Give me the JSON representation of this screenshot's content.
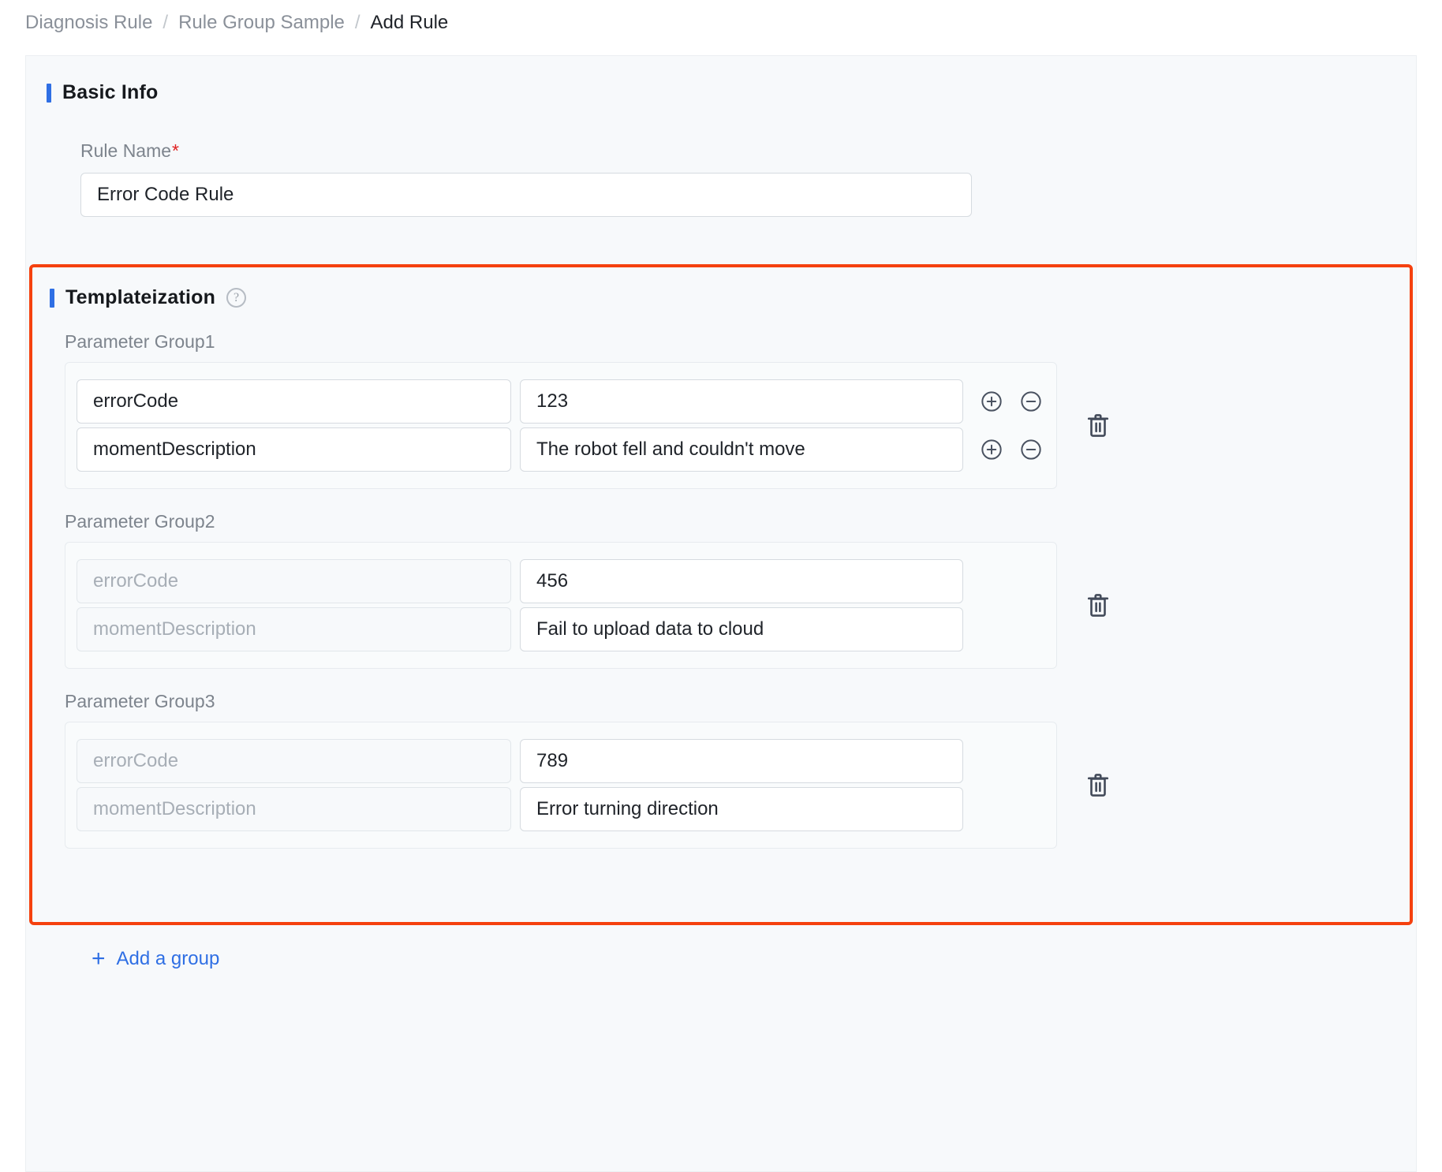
{
  "breadcrumb": {
    "separator": "/",
    "items": [
      {
        "label": "Diagnosis Rule",
        "active": false
      },
      {
        "label": "Rule Group Sample",
        "active": false
      },
      {
        "label": "Add Rule",
        "active": true
      }
    ]
  },
  "basic_info": {
    "title": "Basic Info",
    "rule_name": {
      "label": "Rule Name",
      "required_marker": "*",
      "value": "Error Code Rule",
      "placeholder": "Please enter rule name"
    }
  },
  "templateization": {
    "title": "Templateization",
    "help_icon": "question-circle-icon",
    "groups": [
      {
        "label": "Parameter Group1",
        "has_row_icons": true,
        "rows": [
          {
            "key": "errorCode",
            "key_disabled": false,
            "value": "123"
          },
          {
            "key": "momentDescription",
            "key_disabled": false,
            "value": "The robot fell and couldn't move"
          }
        ]
      },
      {
        "label": "Parameter Group2",
        "has_row_icons": false,
        "rows": [
          {
            "key": "errorCode",
            "key_disabled": true,
            "value": "456"
          },
          {
            "key": "momentDescription",
            "key_disabled": true,
            "value": "Fail to upload data to cloud"
          }
        ]
      },
      {
        "label": "Parameter Group3",
        "has_row_icons": false,
        "rows": [
          {
            "key": "errorCode",
            "key_disabled": true,
            "value": "789"
          },
          {
            "key": "momentDescription",
            "key_disabled": true,
            "value": "Error turning direction"
          }
        ]
      }
    ],
    "icons": {
      "add_row": "plus-circle-icon",
      "remove_row": "minus-circle-icon",
      "delete_group": "trash-icon"
    },
    "highlight_color": "#f5410f"
  },
  "add_group": {
    "plus": "+",
    "label": "Add a group"
  },
  "colors": {
    "accent_blue": "#2f6fe4",
    "required_red": "#e02020",
    "highlight_orange": "#f5410f",
    "panel_bg": "#f7f9fb"
  }
}
